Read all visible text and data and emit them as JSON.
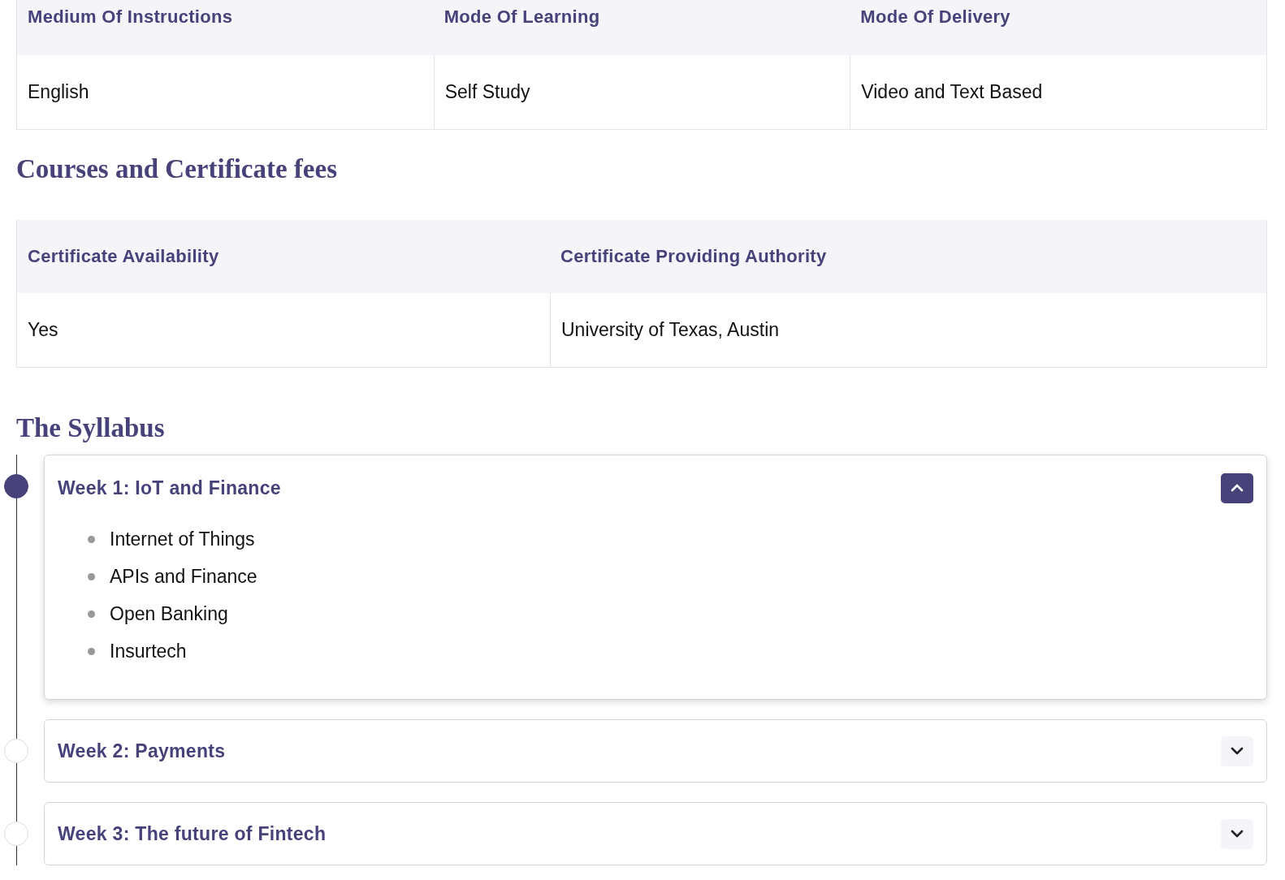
{
  "info_table": {
    "columns": [
      "Medium Of Instructions",
      "Mode Of Learning",
      "Mode Of Delivery"
    ],
    "rows": [
      [
        "English",
        "Self Study",
        "Video and Text Based"
      ]
    ]
  },
  "fees_section": {
    "title": "Courses and Certificate fees"
  },
  "certificate_table": {
    "columns": [
      "Certificate Availability",
      "Certificate Providing Authority"
    ],
    "rows": [
      [
        "Yes",
        "University of Texas, Austin"
      ]
    ]
  },
  "syllabus": {
    "title": "The Syllabus",
    "weeks": [
      {
        "title": "Week 1: IoT and Finance",
        "expanded": true,
        "topics": [
          "Internet of Things",
          "APIs and Finance",
          "Open Banking",
          "Insurtech"
        ]
      },
      {
        "title": "Week 2: Payments",
        "expanded": false
      },
      {
        "title": "Week 3: The future of Fintech",
        "expanded": false
      }
    ]
  }
}
